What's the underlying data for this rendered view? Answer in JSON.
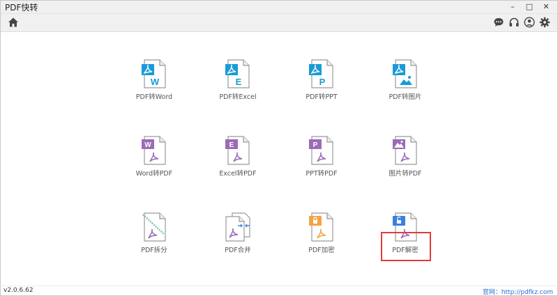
{
  "window": {
    "title": "PDF快转",
    "controls": {
      "minimize": "–",
      "maximize": "□",
      "close": "✕"
    }
  },
  "toolbar": {
    "home_icon": "home-icon",
    "right_icons": [
      "chat-icon",
      "headset-icon",
      "user-icon",
      "gear-icon"
    ]
  },
  "tools": [
    {
      "label": "PDF转Word",
      "icon": "pdf-to-word-icon",
      "badge": "W",
      "color": "#1a9bd7"
    },
    {
      "label": "PDF转Excel",
      "icon": "pdf-to-excel-icon",
      "badge": "E",
      "color": "#1a9bd7"
    },
    {
      "label": "PDF转PPT",
      "icon": "pdf-to-ppt-icon",
      "badge": "P",
      "color": "#1a9bd7"
    },
    {
      "label": "PDF转图片",
      "icon": "pdf-to-image-icon",
      "badge": "",
      "color": "#1a9bd7"
    },
    {
      "label": "Word转PDF",
      "icon": "word-to-pdf-icon",
      "badge": "W",
      "color": "#9b6bb8"
    },
    {
      "label": "Excel转PDF",
      "icon": "excel-to-pdf-icon",
      "badge": "E",
      "color": "#9b6bb8"
    },
    {
      "label": "PPT转PDF",
      "icon": "ppt-to-pdf-icon",
      "badge": "P",
      "color": "#9b6bb8"
    },
    {
      "label": "图片转PDF",
      "icon": "image-to-pdf-icon",
      "badge": "",
      "color": "#9b6bb8"
    },
    {
      "label": "PDF拆分",
      "icon": "pdf-split-icon",
      "badge": "",
      "color": "#7fc4a8"
    },
    {
      "label": "PDF合并",
      "icon": "pdf-merge-icon",
      "badge": "",
      "color": "#3d8fd6"
    },
    {
      "label": "PDF加密",
      "icon": "pdf-encrypt-icon",
      "badge": "",
      "color": "#f2a444"
    },
    {
      "label": "PDF解密",
      "icon": "pdf-decrypt-icon",
      "badge": "",
      "color": "#3d7fe0"
    }
  ],
  "highlighted_tool": "PDF解密",
  "statusbar": {
    "version": "v2.0.6.62",
    "website": "官网：http://pdfkz.com"
  },
  "colors": {
    "pdf_symbol": "#9b6bb8",
    "highlight": "#e23b3b",
    "link": "#2a6ed8"
  }
}
